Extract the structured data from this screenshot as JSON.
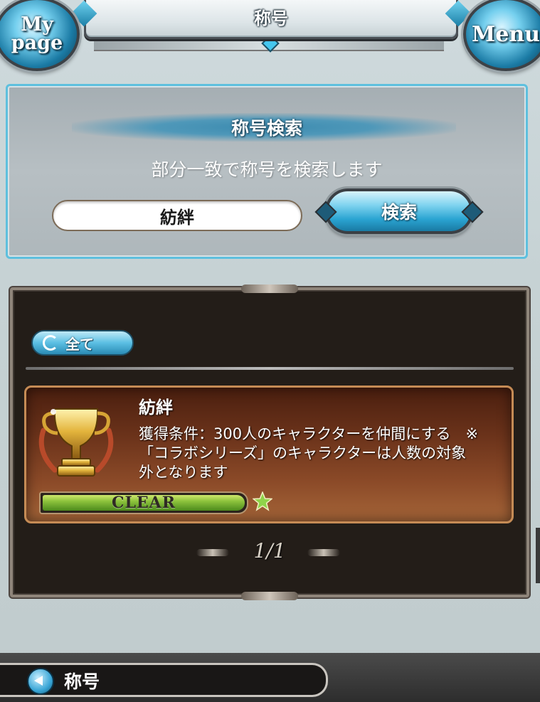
{
  "header": {
    "title": "称号",
    "mypage_label_line1": "My",
    "mypage_label_line2": "page",
    "menu_label": "Menu"
  },
  "search": {
    "heading": "称号検索",
    "description": "部分一致で称号を検索します",
    "input_value": "紡絆",
    "button_label": "検索"
  },
  "results": {
    "filter_label": "全て",
    "items": [
      {
        "name": "紡絆",
        "condition_line1": "獲得条件：300人のキャラクターを仲間にする　※",
        "condition_line2": "「コラボシリーズ」のキャラクターは人数の対象",
        "condition_line3": "外となります",
        "status": "CLEAR",
        "progress": 1.0,
        "icon": "trophy-icon"
      }
    ],
    "pagination": "1/1"
  },
  "footer": {
    "breadcrumb_label": "称号"
  },
  "colors": {
    "accent": "#2aa4d2",
    "card_bg": "#6a321a",
    "progress_green": "#8cc23c"
  }
}
